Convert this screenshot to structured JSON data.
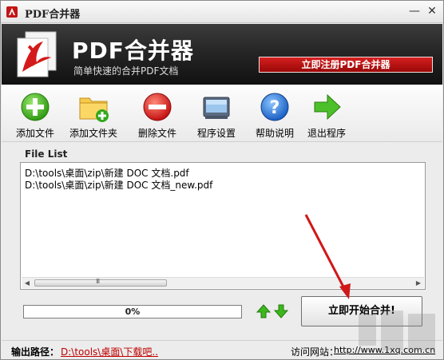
{
  "window": {
    "title": "PDF合并器",
    "minimize_glyph": "—",
    "close_glyph": "✕"
  },
  "banner": {
    "app_name": "PDF合并器",
    "tagline": "简单快速的合并PDF文档",
    "register_label": "立即注册PDF合并器"
  },
  "toolbar": {
    "items": [
      {
        "label": "添加文件",
        "icon": "add-icon"
      },
      {
        "label": "添加文件夹",
        "icon": "add-folder-icon"
      },
      {
        "label": "删除文件",
        "icon": "delete-icon"
      },
      {
        "label": "程序设置",
        "icon": "settings-icon"
      },
      {
        "label": "帮助说明",
        "icon": "help-icon"
      },
      {
        "label": "退出程序",
        "icon": "exit-icon"
      }
    ]
  },
  "file_list": {
    "label": "File List",
    "files": [
      "D:\\tools\\桌面\\zip\\新建 DOC 文档.pdf",
      "D:\\tools\\桌面\\zip\\新建 DOC 文档_new.pdf"
    ],
    "scroll_grip": "III"
  },
  "progress": {
    "value": 0,
    "text": "0%"
  },
  "merge": {
    "label": "立即开始合并!"
  },
  "status": {
    "output_label": "输出路径：",
    "output_path": "D:\\tools\\桌面\\下载吧..",
    "website_label": "访问网站：",
    "website_url": "http://www.1xq.com.cn"
  },
  "colors": {
    "banner_bg": "#1e1e1e",
    "register_red": "#c41515",
    "link_red": "#c00000",
    "annotation_red": "#d01818",
    "progress_green": "#3fa92b"
  }
}
